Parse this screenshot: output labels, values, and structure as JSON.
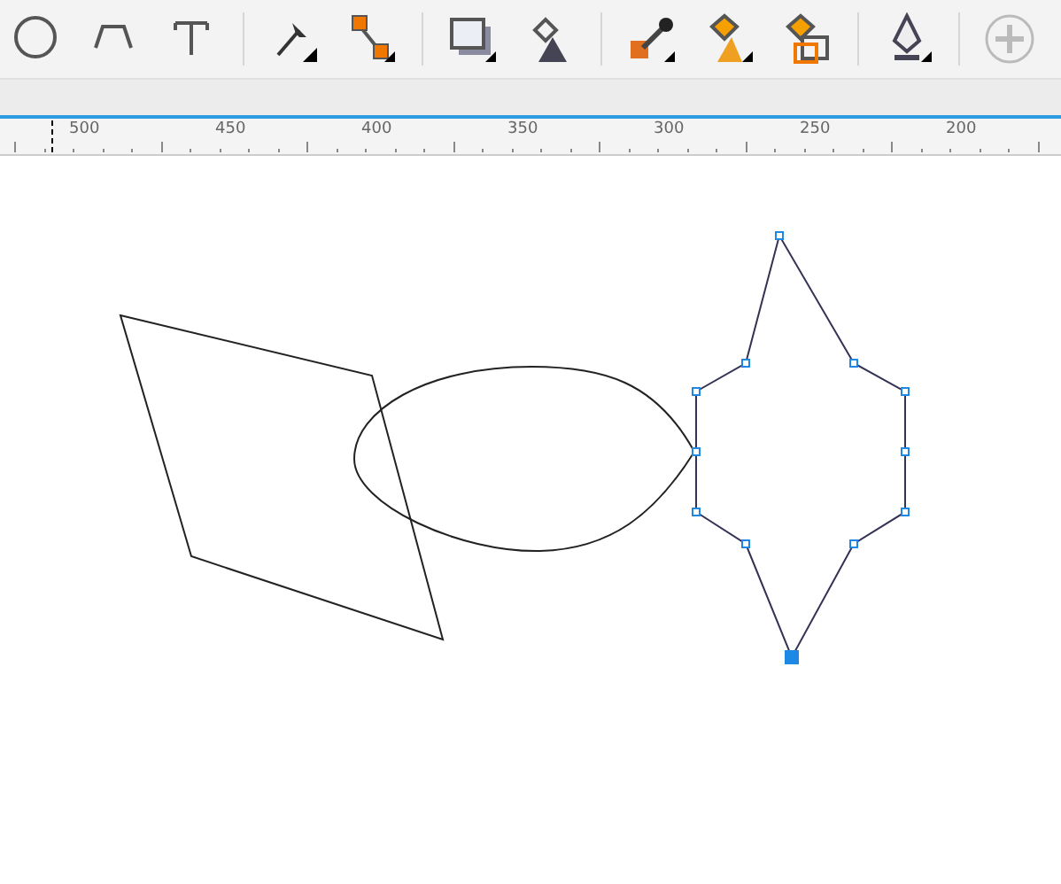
{
  "ruler": {
    "labels": [
      "500",
      "450",
      "400",
      "350",
      "300",
      "250",
      "200"
    ]
  }
}
